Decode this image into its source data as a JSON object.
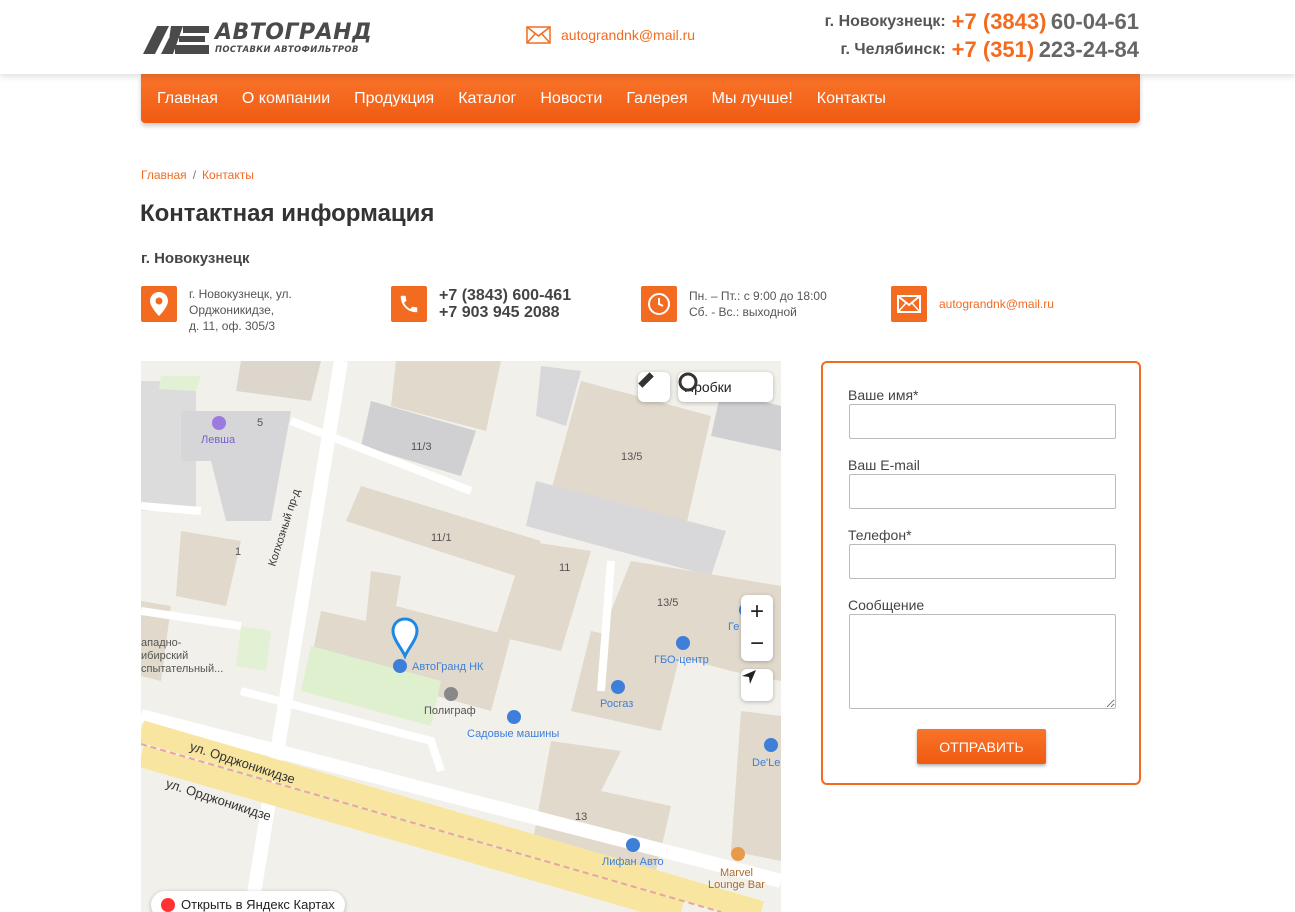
{
  "header": {
    "logo_title": "АВТОГРАНД",
    "logo_subtitle": "ПОСТАВКИ АВТОФИЛЬТРОВ",
    "email": "autograndnk@mail.ru",
    "phones": [
      {
        "city": "г. Новокузнецк:",
        "code": "+7 (3843)",
        "number": "60-04-61"
      },
      {
        "city": "г. Челябинск:",
        "code": "+7 (351)",
        "number": "223-24-84"
      }
    ]
  },
  "nav": {
    "items": [
      {
        "label": "Главная"
      },
      {
        "label": "О компании"
      },
      {
        "label": "Продукция"
      },
      {
        "label": "Каталог"
      },
      {
        "label": "Новости"
      },
      {
        "label": "Галерея"
      },
      {
        "label": "Мы лучше!"
      },
      {
        "label": "Контакты"
      }
    ]
  },
  "breadcrumb": {
    "home": "Главная",
    "separator": "/",
    "current": "Контакты"
  },
  "page": {
    "title": "Контактная информация",
    "city": "г. Новокузнецк"
  },
  "contacts": {
    "address": [
      "г. Новокузнецк, ул.",
      "Орджоникидзе,",
      "д. 11, оф. 305/3"
    ],
    "phones": [
      "+7 (3843) 600-461",
      "+7 903 945 2088"
    ],
    "hours": [
      "Пн. – Пт.: с 9:00 до 18:00",
      "Сб. - Вс.: выходной"
    ],
    "email": "autograndnk@mail.ru"
  },
  "map": {
    "traffic_label": "Пробки",
    "open_label": "Открыть в Яндекс Картах",
    "zoom_in": "+",
    "zoom_out": "−",
    "labels": {
      "levsha": "Левша",
      "b5": "5",
      "b11_3": "11/3",
      "b13_5a": "13/5",
      "b11_1": "11/1",
      "b11": "11",
      "b13_5b": "13/5",
      "b1": "1",
      "b13": "13",
      "street_side": "Колхозный пр-д",
      "street_main_1": "ул. Орджоникидзе",
      "street_main_2": "ул. Орджоникидзе",
      "autogrand": "АвтоГранд НК",
      "gbo": "ГБО-центр",
      "rosgaz": "Росгаз",
      "poligraf": "Полиграф",
      "sad": "Садовые машины",
      "lifan": "Лифан Авто",
      "marvel_1": "Marvel",
      "marvel_2": "Lounge Bar",
      "delen": "De'Le",
      "ge": "Ге",
      "zapad_1": "ападно-",
      "zapad_2": "ибирский",
      "zapad_3": "спытательный..."
    }
  },
  "form": {
    "name_label": "Ваше имя*",
    "email_label": "Ваш E-mail",
    "phone_label": "Телефон*",
    "message_label": "Сообщение",
    "name_value": "",
    "email_value": "",
    "phone_value": "",
    "message_value": "",
    "submit_label": "ОТПРАВИТЬ"
  },
  "colors": {
    "accent": "#f26b20",
    "text": "#333333",
    "map_bg": "#f2f0ea"
  }
}
